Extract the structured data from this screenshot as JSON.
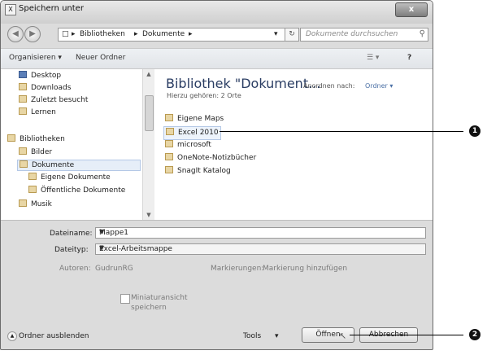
{
  "window": {
    "title": "Speichern unter",
    "close_label": "x"
  },
  "address": {
    "segments": [
      "Bibliotheken",
      "Dokumente"
    ],
    "search_placeholder": "Dokumente durchsuchen"
  },
  "toolbar": {
    "organize_label": "Organisieren ▾",
    "new_folder_label": "Neuer Ordner",
    "view_label": "☰ ▾",
    "help_label": "?"
  },
  "nav": {
    "items": [
      {
        "label": "Desktop"
      },
      {
        "label": "Downloads"
      },
      {
        "label": "Zuletzt besucht"
      },
      {
        "label": "Lernen"
      },
      {
        "label": "Bibliotheken"
      },
      {
        "label": "Bilder"
      },
      {
        "label": "Dokumente"
      },
      {
        "label": "Eigene Dokumente"
      },
      {
        "label": "Öffentliche Dokumente"
      },
      {
        "label": "Musik"
      }
    ]
  },
  "library": {
    "title": "Bibliothek \"Dokument...",
    "subtitle": "Hierzu gehören: 2 Orte",
    "arrange_label": "Anordnen nach:",
    "arrange_value": "Ordner ▾",
    "files": [
      "Eigene Maps",
      "Excel 2010",
      "microsoft",
      "OneNote-Notizbücher",
      "SnagIt Katalog"
    ]
  },
  "form": {
    "filename_label": "Dateiname:",
    "filename_value": "Mappe1",
    "filetype_label": "Dateityp:",
    "filetype_value": "Excel-Arbeitsmappe",
    "authors_label": "Autoren:",
    "authors_value": "GudrunRG",
    "tags_label": "Markierungen:",
    "tags_value": "Markierung hinzufügen",
    "thumbnail_label_1": "Miniaturansicht",
    "thumbnail_label_2": "speichern",
    "hide_folders_label": "Ordner ausblenden",
    "tools_label": "Tools",
    "open_label": "Öffnen",
    "cancel_label": "Abbrechen"
  },
  "callouts": [
    "1",
    "2"
  ]
}
